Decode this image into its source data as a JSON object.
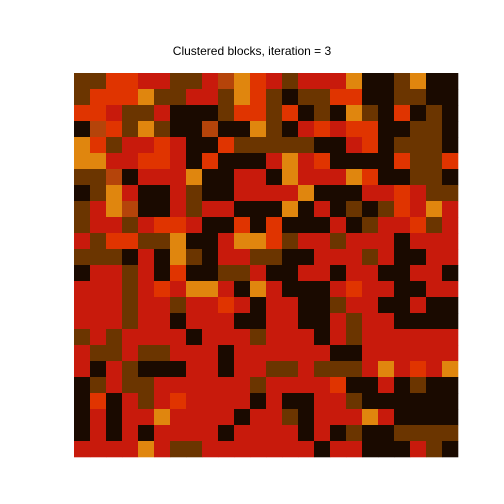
{
  "chart_data": {
    "type": "heatmap",
    "title": "Clustered blocks, iteration = 3",
    "xlabel": "",
    "ylabel": "",
    "n_rows": 24,
    "n_cols": 24,
    "palette": [
      "#1a0a00",
      "#6b3500",
      "#b5440a",
      "#c81a0c",
      "#e03400",
      "#e0860e"
    ],
    "grid": [
      [
        1,
        1,
        4,
        4,
        3,
        3,
        1,
        1,
        3,
        2,
        5,
        4,
        3,
        1,
        3,
        3,
        3,
        5,
        0,
        0,
        1,
        5,
        0,
        0
      ],
      [
        1,
        4,
        4,
        4,
        5,
        1,
        1,
        3,
        3,
        1,
        5,
        4,
        1,
        0,
        1,
        1,
        4,
        4,
        0,
        0,
        1,
        1,
        0,
        0
      ],
      [
        4,
        4,
        3,
        1,
        1,
        3,
        0,
        0,
        0,
        1,
        4,
        4,
        1,
        4,
        0,
        1,
        0,
        5,
        1,
        0,
        4,
        0,
        1,
        0
      ],
      [
        0,
        2,
        4,
        1,
        5,
        1,
        0,
        0,
        2,
        0,
        0,
        5,
        1,
        0,
        3,
        4,
        3,
        4,
        4,
        0,
        0,
        1,
        1,
        0
      ],
      [
        5,
        4,
        1,
        3,
        3,
        4,
        3,
        0,
        0,
        4,
        1,
        1,
        1,
        1,
        1,
        0,
        0,
        3,
        4,
        0,
        1,
        1,
        1,
        0
      ],
      [
        5,
        5,
        3,
        3,
        4,
        4,
        3,
        0,
        4,
        0,
        0,
        0,
        3,
        5,
        3,
        4,
        0,
        0,
        0,
        0,
        4,
        1,
        1,
        4
      ],
      [
        1,
        1,
        2,
        0,
        3,
        3,
        3,
        5,
        0,
        0,
        3,
        3,
        0,
        5,
        3,
        3,
        3,
        5,
        4,
        0,
        0,
        1,
        1,
        0
      ],
      [
        0,
        1,
        5,
        3,
        0,
        0,
        3,
        1,
        0,
        0,
        3,
        3,
        3,
        3,
        5,
        0,
        0,
        0,
        3,
        3,
        4,
        3,
        1,
        1
      ],
      [
        1,
        3,
        5,
        2,
        0,
        0,
        3,
        1,
        3,
        3,
        0,
        0,
        0,
        5,
        0,
        3,
        0,
        1,
        0,
        1,
        4,
        3,
        5,
        3
      ],
      [
        1,
        3,
        3,
        1,
        3,
        4,
        4,
        3,
        0,
        0,
        4,
        0,
        4,
        0,
        0,
        0,
        3,
        0,
        1,
        3,
        3,
        4,
        1,
        3
      ],
      [
        3,
        1,
        4,
        4,
        1,
        1,
        5,
        0,
        0,
        3,
        5,
        5,
        4,
        1,
        3,
        3,
        1,
        3,
        3,
        3,
        0,
        3,
        3,
        3
      ],
      [
        1,
        1,
        1,
        0,
        3,
        0,
        5,
        1,
        0,
        3,
        3,
        1,
        1,
        0,
        0,
        3,
        3,
        3,
        1,
        3,
        0,
        0,
        3,
        3
      ],
      [
        0,
        3,
        3,
        1,
        3,
        0,
        4,
        0,
        0,
        1,
        1,
        3,
        0,
        0,
        3,
        3,
        0,
        3,
        3,
        0,
        0,
        3,
        3,
        0
      ],
      [
        3,
        3,
        3,
        1,
        3,
        4,
        3,
        5,
        5,
        3,
        0,
        5,
        3,
        0,
        0,
        0,
        3,
        4,
        3,
        3,
        0,
        0,
        3,
        3
      ],
      [
        3,
        3,
        3,
        1,
        3,
        3,
        1,
        3,
        3,
        4,
        3,
        0,
        3,
        3,
        0,
        0,
        1,
        3,
        3,
        0,
        0,
        3,
        0,
        0
      ],
      [
        3,
        3,
        3,
        1,
        3,
        3,
        0,
        3,
        3,
        3,
        0,
        0,
        3,
        3,
        0,
        0,
        3,
        1,
        3,
        3,
        0,
        0,
        0,
        0
      ],
      [
        1,
        3,
        1,
        3,
        3,
        3,
        3,
        0,
        3,
        3,
        3,
        1,
        3,
        3,
        3,
        0,
        3,
        1,
        3,
        3,
        3,
        3,
        3,
        3
      ],
      [
        3,
        1,
        1,
        3,
        1,
        1,
        3,
        3,
        3,
        0,
        3,
        3,
        3,
        3,
        3,
        3,
        0,
        0,
        3,
        3,
        3,
        3,
        3,
        3
      ],
      [
        3,
        0,
        3,
        1,
        0,
        0,
        0,
        3,
        3,
        0,
        3,
        3,
        1,
        1,
        3,
        1,
        1,
        1,
        3,
        5,
        3,
        4,
        3,
        5
      ],
      [
        0,
        1,
        3,
        1,
        1,
        3,
        3,
        3,
        3,
        3,
        3,
        1,
        3,
        3,
        3,
        3,
        4,
        0,
        0,
        3,
        0,
        1,
        0,
        0
      ],
      [
        0,
        4,
        0,
        3,
        1,
        3,
        4,
        3,
        3,
        3,
        3,
        0,
        3,
        0,
        0,
        3,
        3,
        1,
        0,
        0,
        0,
        0,
        0,
        0
      ],
      [
        0,
        3,
        0,
        3,
        3,
        5,
        3,
        3,
        3,
        3,
        0,
        3,
        3,
        1,
        0,
        3,
        3,
        3,
        5,
        3,
        0,
        0,
        0,
        0
      ],
      [
        0,
        3,
        0,
        3,
        0,
        3,
        3,
        3,
        3,
        0,
        3,
        3,
        3,
        3,
        0,
        3,
        0,
        1,
        0,
        0,
        1,
        1,
        1,
        1
      ],
      [
        3,
        3,
        3,
        3,
        5,
        3,
        1,
        1,
        3,
        3,
        3,
        3,
        3,
        3,
        3,
        0,
        3,
        3,
        0,
        0,
        0,
        3,
        1,
        0
      ]
    ]
  }
}
